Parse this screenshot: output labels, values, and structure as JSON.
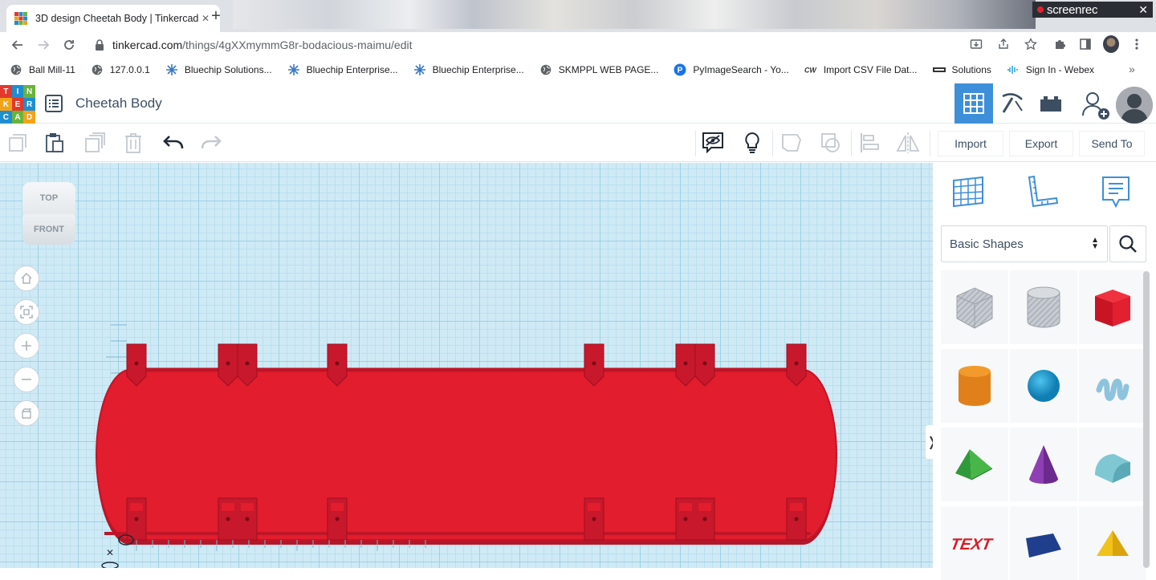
{
  "browser": {
    "tab_title": "3D design Cheetah Body | Tinkercad",
    "url_host": "tinkercad.com",
    "url_path": "/things/4gXXmymmG8r-bodacious-maimu/edit",
    "screenrec_label": "screenrec",
    "bookmarks": [
      {
        "label": "Ball Mill-11",
        "icon": "globe-icon"
      },
      {
        "label": "127.0.0.1",
        "icon": "globe-icon"
      },
      {
        "label": "Bluechip Solutions...",
        "icon": "bluechip-icon"
      },
      {
        "label": "Bluechip Enterprise...",
        "icon": "bluechip-icon"
      },
      {
        "label": "Bluechip Enterprise...",
        "icon": "bluechip-icon"
      },
      {
        "label": "SKMPPL WEB PAGE...",
        "icon": "globe-icon"
      },
      {
        "label": "PyImageSearch - Yo...",
        "icon": "pyimagesearch-icon"
      },
      {
        "label": "Import CSV File Dat...",
        "icon": "cw-icon"
      },
      {
        "label": "Solutions",
        "icon": "solutions-icon"
      },
      {
        "label": "Sign In - Webex",
        "icon": "webex-icon"
      }
    ]
  },
  "app": {
    "logo_letters": [
      "T",
      "I",
      "N",
      "K",
      "E",
      "R",
      "C",
      "A",
      "D"
    ],
    "design_title": "Cheetah Body",
    "view_cube": {
      "top": "TOP",
      "front": "FRONT"
    },
    "actions": {
      "import": "Import",
      "export": "Export",
      "send_to": "Send To"
    },
    "shape_library": "Basic Shapes",
    "shapes": [
      "box-striped",
      "cylinder-striped",
      "box",
      "cylinder",
      "sphere",
      "scribble",
      "roof",
      "cone",
      "round-roof",
      "text",
      "wedge",
      "pyramid"
    ],
    "model_color": "#e11d2e",
    "accent_color": "#3e8fda"
  }
}
